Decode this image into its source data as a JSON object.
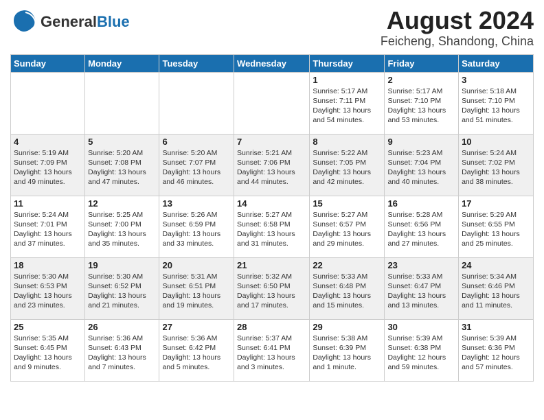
{
  "logo": {
    "general": "General",
    "blue": "Blue"
  },
  "title": "August 2024",
  "subtitle": "Feicheng, Shandong, China",
  "days_of_week": [
    "Sunday",
    "Monday",
    "Tuesday",
    "Wednesday",
    "Thursday",
    "Friday",
    "Saturday"
  ],
  "weeks": [
    [
      {
        "day": "",
        "info": ""
      },
      {
        "day": "",
        "info": ""
      },
      {
        "day": "",
        "info": ""
      },
      {
        "day": "",
        "info": ""
      },
      {
        "day": "1",
        "info": "Sunrise: 5:17 AM\nSunset: 7:11 PM\nDaylight: 13 hours\nand 54 minutes."
      },
      {
        "day": "2",
        "info": "Sunrise: 5:17 AM\nSunset: 7:10 PM\nDaylight: 13 hours\nand 53 minutes."
      },
      {
        "day": "3",
        "info": "Sunrise: 5:18 AM\nSunset: 7:10 PM\nDaylight: 13 hours\nand 51 minutes."
      }
    ],
    [
      {
        "day": "4",
        "info": "Sunrise: 5:19 AM\nSunset: 7:09 PM\nDaylight: 13 hours\nand 49 minutes."
      },
      {
        "day": "5",
        "info": "Sunrise: 5:20 AM\nSunset: 7:08 PM\nDaylight: 13 hours\nand 47 minutes."
      },
      {
        "day": "6",
        "info": "Sunrise: 5:20 AM\nSunset: 7:07 PM\nDaylight: 13 hours\nand 46 minutes."
      },
      {
        "day": "7",
        "info": "Sunrise: 5:21 AM\nSunset: 7:06 PM\nDaylight: 13 hours\nand 44 minutes."
      },
      {
        "day": "8",
        "info": "Sunrise: 5:22 AM\nSunset: 7:05 PM\nDaylight: 13 hours\nand 42 minutes."
      },
      {
        "day": "9",
        "info": "Sunrise: 5:23 AM\nSunset: 7:04 PM\nDaylight: 13 hours\nand 40 minutes."
      },
      {
        "day": "10",
        "info": "Sunrise: 5:24 AM\nSunset: 7:02 PM\nDaylight: 13 hours\nand 38 minutes."
      }
    ],
    [
      {
        "day": "11",
        "info": "Sunrise: 5:24 AM\nSunset: 7:01 PM\nDaylight: 13 hours\nand 37 minutes."
      },
      {
        "day": "12",
        "info": "Sunrise: 5:25 AM\nSunset: 7:00 PM\nDaylight: 13 hours\nand 35 minutes."
      },
      {
        "day": "13",
        "info": "Sunrise: 5:26 AM\nSunset: 6:59 PM\nDaylight: 13 hours\nand 33 minutes."
      },
      {
        "day": "14",
        "info": "Sunrise: 5:27 AM\nSunset: 6:58 PM\nDaylight: 13 hours\nand 31 minutes."
      },
      {
        "day": "15",
        "info": "Sunrise: 5:27 AM\nSunset: 6:57 PM\nDaylight: 13 hours\nand 29 minutes."
      },
      {
        "day": "16",
        "info": "Sunrise: 5:28 AM\nSunset: 6:56 PM\nDaylight: 13 hours\nand 27 minutes."
      },
      {
        "day": "17",
        "info": "Sunrise: 5:29 AM\nSunset: 6:55 PM\nDaylight: 13 hours\nand 25 minutes."
      }
    ],
    [
      {
        "day": "18",
        "info": "Sunrise: 5:30 AM\nSunset: 6:53 PM\nDaylight: 13 hours\nand 23 minutes."
      },
      {
        "day": "19",
        "info": "Sunrise: 5:30 AM\nSunset: 6:52 PM\nDaylight: 13 hours\nand 21 minutes."
      },
      {
        "day": "20",
        "info": "Sunrise: 5:31 AM\nSunset: 6:51 PM\nDaylight: 13 hours\nand 19 minutes."
      },
      {
        "day": "21",
        "info": "Sunrise: 5:32 AM\nSunset: 6:50 PM\nDaylight: 13 hours\nand 17 minutes."
      },
      {
        "day": "22",
        "info": "Sunrise: 5:33 AM\nSunset: 6:48 PM\nDaylight: 13 hours\nand 15 minutes."
      },
      {
        "day": "23",
        "info": "Sunrise: 5:33 AM\nSunset: 6:47 PM\nDaylight: 13 hours\nand 13 minutes."
      },
      {
        "day": "24",
        "info": "Sunrise: 5:34 AM\nSunset: 6:46 PM\nDaylight: 13 hours\nand 11 minutes."
      }
    ],
    [
      {
        "day": "25",
        "info": "Sunrise: 5:35 AM\nSunset: 6:45 PM\nDaylight: 13 hours\nand 9 minutes."
      },
      {
        "day": "26",
        "info": "Sunrise: 5:36 AM\nSunset: 6:43 PM\nDaylight: 13 hours\nand 7 minutes."
      },
      {
        "day": "27",
        "info": "Sunrise: 5:36 AM\nSunset: 6:42 PM\nDaylight: 13 hours\nand 5 minutes."
      },
      {
        "day": "28",
        "info": "Sunrise: 5:37 AM\nSunset: 6:41 PM\nDaylight: 13 hours\nand 3 minutes."
      },
      {
        "day": "29",
        "info": "Sunrise: 5:38 AM\nSunset: 6:39 PM\nDaylight: 13 hours\nand 1 minute."
      },
      {
        "day": "30",
        "info": "Sunrise: 5:39 AM\nSunset: 6:38 PM\nDaylight: 12 hours\nand 59 minutes."
      },
      {
        "day": "31",
        "info": "Sunrise: 5:39 AM\nSunset: 6:36 PM\nDaylight: 12 hours\nand 57 minutes."
      }
    ]
  ]
}
